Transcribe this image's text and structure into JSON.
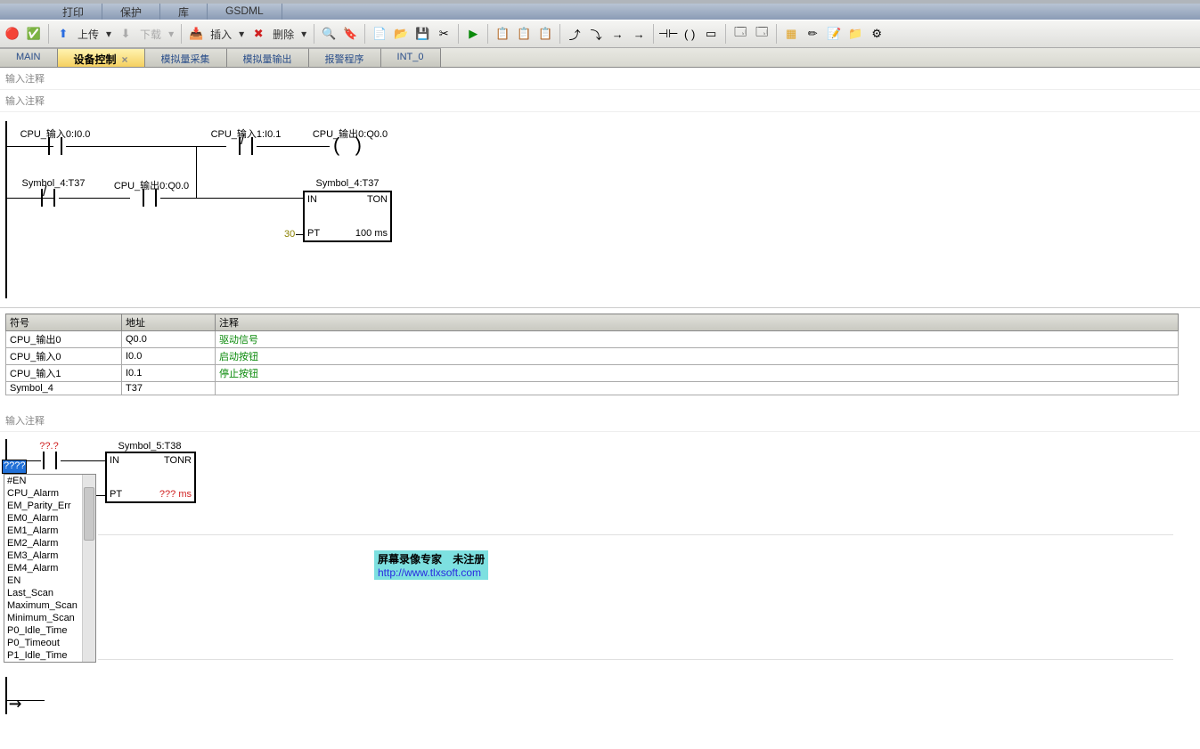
{
  "menubar": {
    "items": [
      "打印",
      "保护",
      "库",
      "GSDML"
    ]
  },
  "toolbar": {
    "upload": "上传",
    "download": "下载",
    "insert": "插入",
    "delete": "删除"
  },
  "tabs": [
    {
      "label": "MAIN",
      "active": false
    },
    {
      "label": "设备控制",
      "active": true
    },
    {
      "label": "模拟量采集",
      "active": false
    },
    {
      "label": "模拟量输出",
      "active": false
    },
    {
      "label": "报警程序",
      "active": false
    },
    {
      "label": "INT_0",
      "active": false
    }
  ],
  "comment_label": "输入注释",
  "rung1": {
    "c1": "CPU_输入0:I0.0",
    "c2": "CPU_输入1:I0.1",
    "out": "CPU_输出0:Q0.0",
    "c3": "Symbol_4:T37",
    "c4": "CPU_输出0:Q0.0",
    "block_label": "Symbol_4:T37",
    "in": "IN",
    "ton": "TON",
    "pt": "PT",
    "ptval": "100 ms",
    "ptnum": "30"
  },
  "symtable": {
    "headers": [
      "符号",
      "地址",
      "注释"
    ],
    "rows": [
      {
        "sym": "CPU_输出0",
        "addr": "Q0.0",
        "cmt": "驱动信号"
      },
      {
        "sym": "CPU_输入0",
        "addr": "I0.0",
        "cmt": "启动按钮"
      },
      {
        "sym": "CPU_输入1",
        "addr": "I0.1",
        "cmt": "停止按钮"
      },
      {
        "sym": "Symbol_4",
        "addr": "T37",
        "cmt": ""
      }
    ]
  },
  "rung2": {
    "unk": "??.?",
    "block_label": "Symbol_5:T38",
    "in": "IN",
    "tonr": "TONR",
    "pt": "PT",
    "ptval": "??? ms",
    "input_val": "????"
  },
  "dropdown": {
    "items": [
      "#EN",
      "CPU_Alarm",
      "EM_Parity_Err",
      "EM0_Alarm",
      "EM1_Alarm",
      "EM2_Alarm",
      "EM3_Alarm",
      "EM4_Alarm",
      "EN",
      "Last_Scan",
      "Maximum_Scan",
      "Minimum_Scan",
      "P0_Idle_Time",
      "P0_Timeout",
      "P1_Idle_Time"
    ]
  },
  "watermark": {
    "text1": "屏幕录像专家",
    "text2": "未注册",
    "url": "http://www.tlxsoft.com"
  }
}
